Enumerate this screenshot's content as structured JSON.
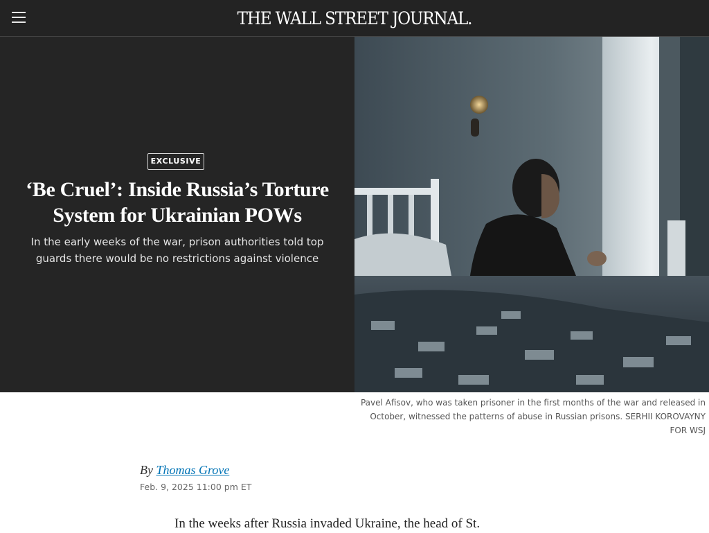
{
  "header": {
    "logo_text": "THE WALL STREET JOURNAL.",
    "menu_icon": "hamburger-menu-icon"
  },
  "hero": {
    "badge": "EXCLUSIVE",
    "headline": "‘Be Cruel’: Inside Russia’s Torture System for Ukrainian POWs",
    "dek": "In the early weeks of the war, prison authorities told top guards there would be no restrictions against violence",
    "background_color": "#252525"
  },
  "photo": {
    "caption": "Pavel Afisov, who was taken prisoner in the first months of the war and released in October, witnessed the patterns of abuse in Russian prisons. SERHII KOROVAYNY FOR WSJ"
  },
  "article": {
    "byline_prefix": "By",
    "author": "Thomas Grove",
    "date": "Feb. 9, 2025 11:00 pm ET",
    "first_line": "In the weeks after Russia invaded Ukraine, the head of St."
  },
  "colors": {
    "header_bg": "#232323",
    "link": "#0274b6"
  }
}
